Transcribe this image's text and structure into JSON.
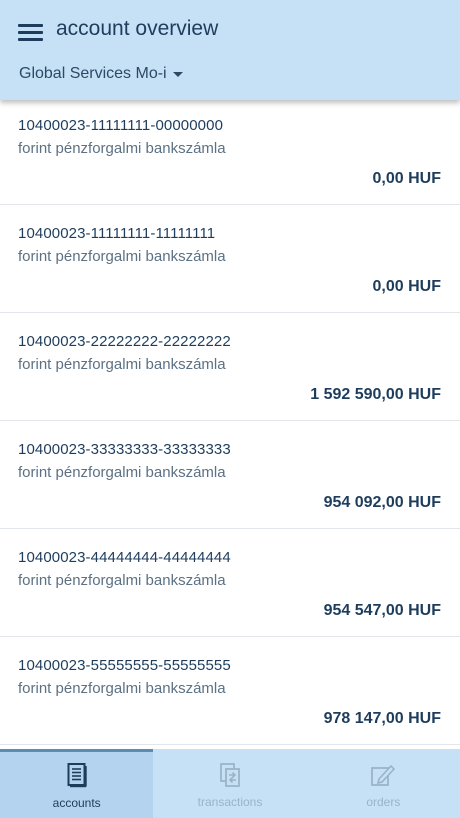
{
  "header": {
    "title": "account overview",
    "company": "Global Services Mo-i"
  },
  "accounts": [
    {
      "number": "10400023-11111111-00000000",
      "type": "forint pénzforgalmi bankszámla",
      "balance": "0,00 HUF"
    },
    {
      "number": "10400023-11111111-11111111",
      "type": "forint pénzforgalmi bankszámla",
      "balance": "0,00 HUF"
    },
    {
      "number": "10400023-22222222-22222222",
      "type": "forint pénzforgalmi bankszámla",
      "balance": "1 592 590,00 HUF"
    },
    {
      "number": "10400023-33333333-33333333",
      "type": "forint pénzforgalmi bankszámla",
      "balance": "954 092,00 HUF"
    },
    {
      "number": "10400023-44444444-44444444",
      "type": "forint pénzforgalmi bankszámla",
      "balance": "954 547,00 HUF"
    },
    {
      "number": "10400023-55555555-55555555",
      "type": "forint pénzforgalmi bankszámla",
      "balance": "978 147,00 HUF"
    }
  ],
  "tabs": [
    {
      "label": "accounts",
      "icon": "document-icon",
      "active": true
    },
    {
      "label": "transactions",
      "icon": "transfer-icon",
      "active": false
    },
    {
      "label": "orders",
      "icon": "edit-icon",
      "active": false
    }
  ],
  "colors": {
    "header_bg": "#c6e0f5",
    "text_primary": "#1e3d5c",
    "text_secondary": "#5c7184",
    "tab_inactive": "#9bb3c7"
  }
}
